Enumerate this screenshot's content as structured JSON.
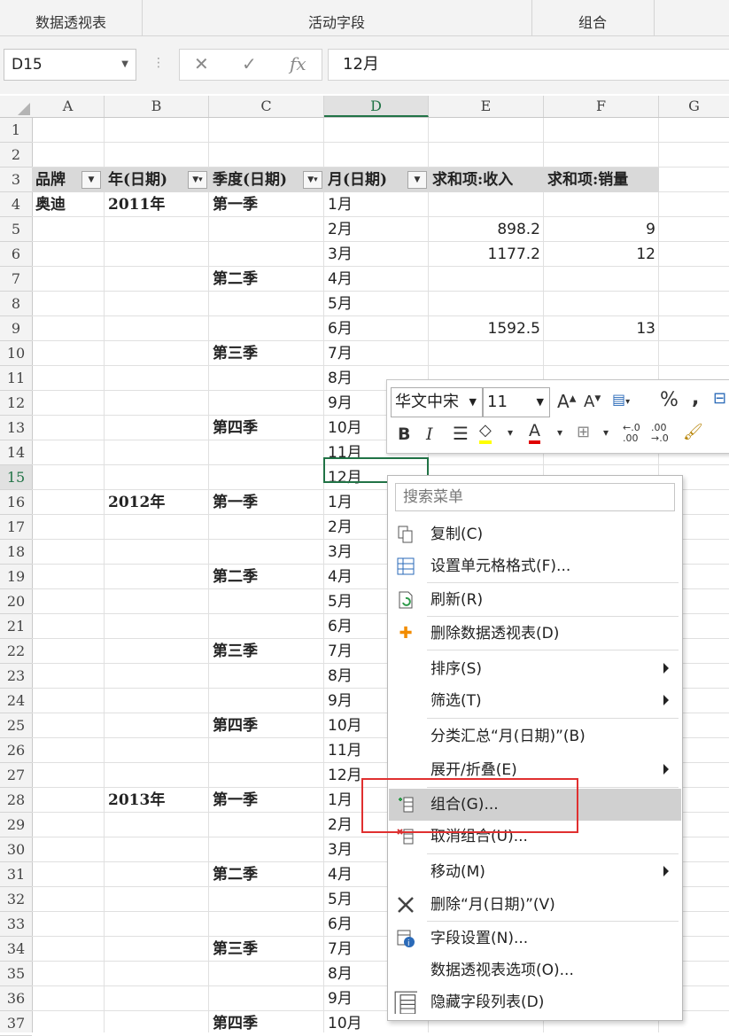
{
  "ribbon": {
    "groups": [
      "数据透视表",
      "活动字段",
      "组合"
    ]
  },
  "formula_bar": {
    "name_box": "D15",
    "value": "12月",
    "fx": "fx"
  },
  "columns": [
    "A",
    "B",
    "C",
    "D",
    "E",
    "F",
    "G"
  ],
  "rows": [
    "1",
    "2",
    "3",
    "4",
    "5",
    "6",
    "7",
    "8",
    "9",
    "10",
    "11",
    "12",
    "13",
    "14",
    "15",
    "16",
    "17",
    "18",
    "19",
    "20",
    "21",
    "22",
    "23",
    "24",
    "25",
    "26",
    "27",
    "28",
    "29",
    "30",
    "31",
    "32",
    "33",
    "34",
    "35",
    "36",
    "37"
  ],
  "pivot": {
    "headers": [
      "品牌",
      "年(日期)",
      "季度(日期)",
      "月(日期)",
      "求和项:收入",
      "求和项:销量"
    ],
    "brand": "奥迪",
    "years": [
      "2011年",
      "2012年",
      "2013年"
    ],
    "quarters": [
      "第一季",
      "第二季",
      "第三季",
      "第四季"
    ],
    "months": [
      "1月",
      "2月",
      "3月",
      "4月",
      "5月",
      "6月",
      "7月",
      "8月",
      "9月",
      "10月",
      "11月",
      "12月"
    ],
    "values": [
      {
        "revenue": "898.2",
        "sales": "9"
      },
      {
        "revenue": "1177.2",
        "sales": "12"
      },
      {
        "revenue": "1592.5",
        "sales": "13"
      }
    ]
  },
  "mini_toolbar": {
    "font": "华文中宋",
    "size": "11",
    "percent": "%"
  },
  "context_menu": {
    "search_placeholder": "搜索菜单",
    "items": [
      "复制(C)",
      "设置单元格格式(F)...",
      "刷新(R)",
      "删除数据透视表(D)",
      "排序(S)",
      "筛选(T)",
      "分类汇总“月(日期)”(B)",
      "展开/折叠(E)",
      "组合(G)...",
      "取消组合(U)...",
      "移动(M)",
      "删除“月(日期)”(V)",
      "字段设置(N)...",
      "数据透视表选项(O)...",
      "隐藏字段列表(D)"
    ]
  },
  "colors": {
    "accent": "#217346",
    "highlight_box": "#e03030",
    "menu_highlight": "#d0d0d0"
  }
}
